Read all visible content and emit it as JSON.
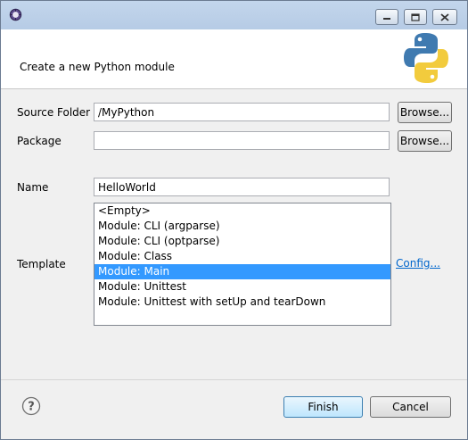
{
  "window": {
    "title": ""
  },
  "banner": {
    "title": "Create a new Python module"
  },
  "form": {
    "source_folder": {
      "label": "Source Folder",
      "value": "/MyPython",
      "browse": "Browse..."
    },
    "package": {
      "label": "Package",
      "value": "",
      "browse": "Browse..."
    },
    "name": {
      "label": "Name",
      "value": "HelloWorld"
    },
    "template": {
      "label": "Template",
      "items": [
        "<Empty>",
        "Module: CLI (argparse)",
        "Module: CLI (optparse)",
        "Module: Class",
        "Module: Main",
        "Module: Unittest",
        "Module: Unittest with setUp and tearDown"
      ],
      "selected": "Module: Main",
      "config_link": "Config..."
    }
  },
  "footer": {
    "finish": "Finish",
    "cancel": "Cancel"
  },
  "icons": [
    "app-icon",
    "minimize-icon",
    "maximize-icon",
    "close-icon",
    "python-logo-icon",
    "help-icon"
  ],
  "colors": {
    "selection": "#3399ff",
    "link": "#0066cc",
    "python_blue": "#3f7ab0",
    "python_yellow": "#f2cb3d"
  }
}
